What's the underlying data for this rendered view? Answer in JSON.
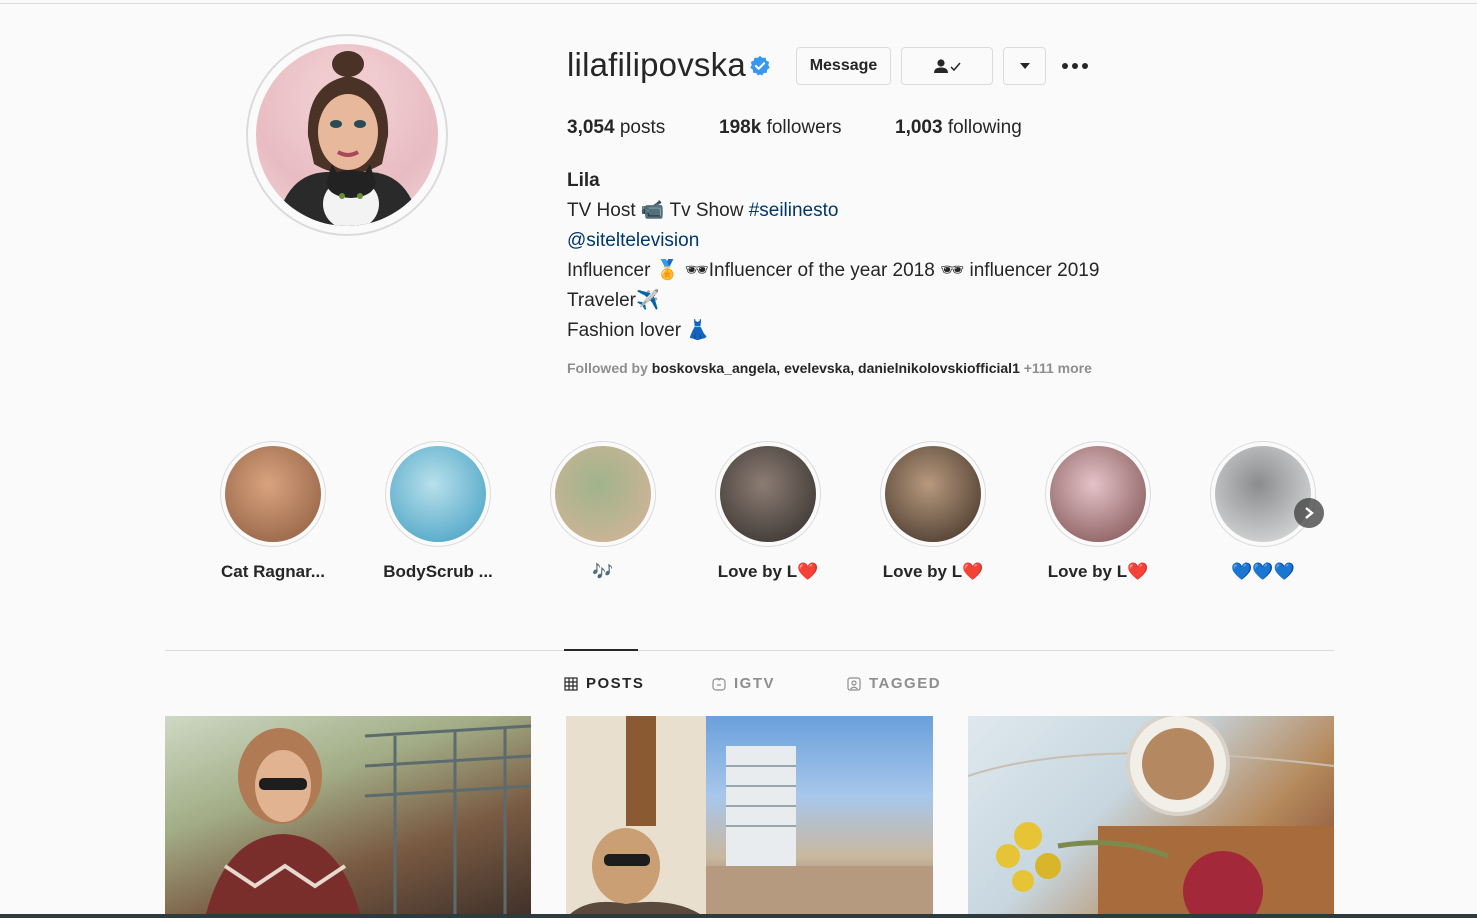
{
  "profile": {
    "username": "lilafilipovska",
    "verified": true,
    "buttons": {
      "message": "Message"
    },
    "stats": {
      "posts_count": "3,054",
      "posts_label": "posts",
      "followers_count": "198k",
      "followers_label": "followers",
      "following_count": "1,003",
      "following_label": "following"
    },
    "bio": {
      "name": "Lila",
      "line1_a": "TV Host 📹 Tv Show ",
      "line1_hashtag": "#seilinesto",
      "line2_mention": "@siteltelevision",
      "line3": "Influencer 🏅 🕶Influencer of the year 2018 🕶 influencer 2019",
      "line4": "Traveler✈️",
      "line5": "Fashion lover 👗"
    },
    "followed_by": {
      "prefix": "Followed by ",
      "names": "boskovska_angela, evelevska, danielnikolovskiofficial1",
      "more": " +111 more"
    }
  },
  "highlights": [
    {
      "label": "Cat Ragnar...",
      "color_a": "#d9a37e",
      "color_b": "#8a5a3e"
    },
    {
      "label": "BodyScrub ...",
      "color_a": "#b8e0ec",
      "color_b": "#3c9cc0"
    },
    {
      "label": "🎶",
      "color_a": "#9fb48a",
      "color_b": "#d8b49a"
    },
    {
      "label": "Love by L❤️",
      "color_a": "#8c7d74",
      "color_b": "#2f2a27"
    },
    {
      "label": "Love by L❤️",
      "color_a": "#b89a7e",
      "color_b": "#3b2c23"
    },
    {
      "label": "Love by L❤️",
      "color_a": "#e4c3c8",
      "color_b": "#7a4b4b"
    },
    {
      "label": "💙💙💙",
      "color_a": "#8a8c8e",
      "color_b": "#e6e6e6"
    }
  ],
  "tabs": [
    {
      "label": "POSTS",
      "active": true
    },
    {
      "label": "IGTV",
      "active": false
    },
    {
      "label": "TAGGED",
      "active": false
    }
  ],
  "colors": {
    "text": "#262626",
    "secondary": "#8e8e8e",
    "link": "#00376b",
    "verified": "#3897f0",
    "border": "#dbdbdb"
  }
}
